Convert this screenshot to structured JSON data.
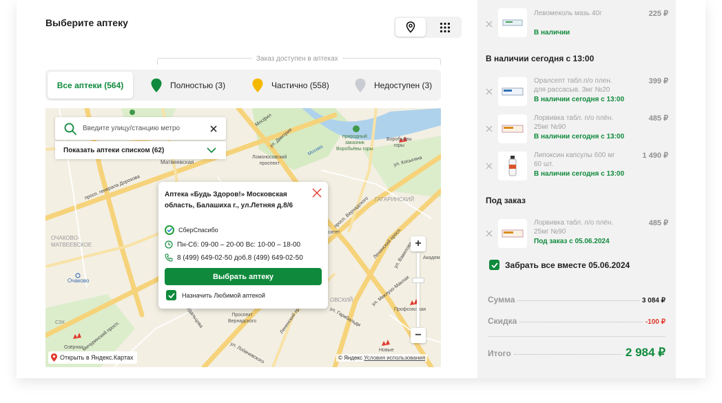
{
  "page": {
    "title": "Выберите аптеку"
  },
  "view_toggle": {
    "map_icon": "map-pin-icon",
    "list_icon": "grid-icon"
  },
  "availability": {
    "caption": "Заказ доступен в аптеках"
  },
  "filters": [
    {
      "label": "Все аптеки (564)",
      "active": true
    },
    {
      "label": "Полностью (3)",
      "pin_color": "#0f8a3c"
    },
    {
      "label": "Частично (558)",
      "pin_color": "#f5b800"
    },
    {
      "label": "Недоступен (3)",
      "pin_color": "#c9ccd2"
    }
  ],
  "map": {
    "search_placeholder": "Введите улицу/станцию метро",
    "show_list": "Показать аптеки списком (62)",
    "labels": {
      "matveevskaya": "Матвеевская",
      "ochakovo_matveevskoe": "ОЧАКОВО-\nМАТВЕЕВСКОЕ",
      "ochakovo": "Очаково",
      "lomonosovsky": "Ломоносовский\nпроспект",
      "vorobyovy_zakaznik": "природный\nзаказник\nВоробьёвы горы",
      "vorobyovy": "Воробьёвы\nгоры",
      "gagarinsky": "ГАГАРИНСКИЙ",
      "prospekt_vernadskogo": "Проспект\nВернадского",
      "profsoyuznaya": "Профсоюзная",
      "ozernaya": "Озёрная",
      "novye": "Новые",
      "akadem": "Академ",
      "generala_dorokhova": "просп. генерала Дорохова",
      "moskva": "Москва",
      "mosfilm": "Мосфил",
      "kosygina": "ул. Косыгина",
      "dmitriya": "ул. Дмитрия",
      "vernadskogo": "просп. Вернадского",
      "leninsky": "Ленинский просп.",
      "vavilova": "ул. Вавилова",
      "miklukho": "ул. Миклухо-Маклая",
      "michurinsky": "Мичуринский просп.",
      "udaltsova": "ул. Удальцова",
      "lobachevskogo": "ул. Лобачевского",
      "garibaldi": "ул. Гарибальди",
      "tsz": "СЗХ",
      "obskiy": "ОВСКИЙ",
      "situet": "ситет",
      "ya_link": "Открыть в Яндекс.Картах",
      "copyright": "© Яндекс",
      "terms": "Условия использования"
    },
    "popup": {
      "name": "Аптека «Будь Здоров!» Московская область, Балашиха г., ул.Летняя д.8/6",
      "loyalty": "СберСпасибо",
      "hours": "Пн-Сб: 09-00 – 20-00 Вс: 10-00 – 18-00",
      "phones": "8 (499) 649-02-50 доб.8 (499) 649-02-50",
      "choose_button": "Выбрать аптеку",
      "favorite": "Назначить Любимой аптекой",
      "favorite_checked": true
    }
  },
  "cart": {
    "top_item": {
      "name": "Левомеколь мазь 40г",
      "price": "225 ₽",
      "status": "В наличии"
    },
    "today_title": "В наличии сегодня с 13:00",
    "today_items": [
      {
        "name": "Оралсепт табл.п/о плен. для рассасыв. 3мг №20",
        "price": "399 ₽",
        "status": "В наличии сегодня с 13:00"
      },
      {
        "name": "Лорвивка табл. п/о плён. 25мг №90",
        "price": "485 ₽",
        "status": "В наличии сегодня с 13:00"
      },
      {
        "name": "Липоксин капсулы 600 мг 60 шт.",
        "price": "1 490 ₽",
        "status": "В наличии сегодня с 13:00"
      }
    ],
    "order_title": "Под заказ",
    "order_items": [
      {
        "name": "Лорвивка табл. п/о плён. 25мг №90",
        "price": "485 ₽",
        "status": "Под заказ с 05.06.2024"
      }
    ],
    "pickup_together": "Забрать все вместе 05.06.2024",
    "pickup_checked": true,
    "sum_label": "Сумма",
    "sum_value": "3 084 ₽",
    "discount_label": "Скидка",
    "discount_value": "-100 ₽",
    "total_label": "Итого",
    "total_value": "2 984 ₽"
  },
  "colors": {
    "accent": "#0f8a3c",
    "discount": "#e03a2c",
    "metro": "#e03a2c"
  }
}
